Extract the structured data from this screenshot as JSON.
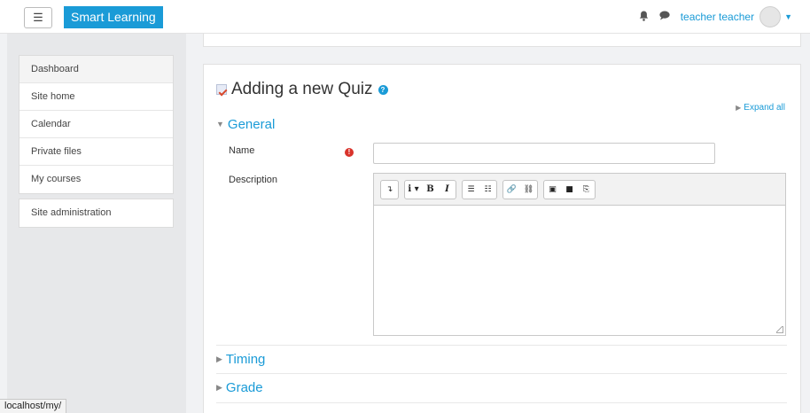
{
  "navbar": {
    "menu_icon": "☰",
    "brand": "Smart Learning",
    "bell_icon": "bell-icon",
    "chat_icon": "chat-icon",
    "user_name": "teacher teacher"
  },
  "drawer": {
    "items": [
      {
        "label": "Dashboard"
      },
      {
        "label": "Site home"
      },
      {
        "label": "Calendar"
      },
      {
        "label": "Private files"
      },
      {
        "label": "My courses"
      }
    ],
    "admin_label": "Site administration"
  },
  "main": {
    "heading": "Adding a new Quiz",
    "help_glyph": "?",
    "expand_all": "Expand all",
    "sections": {
      "general": "General",
      "timing": "Timing",
      "grade": "Grade"
    },
    "fields": {
      "name_label": "Name",
      "name_value": "",
      "required_glyph": "!",
      "description_label": "Description",
      "description_value": ""
    },
    "editor_toolbar": [
      [
        "↴"
      ],
      [
        "i ▾",
        "B",
        "I"
      ],
      [
        "☰",
        "☷"
      ],
      [
        "🔗",
        "⛓"
      ],
      [
        "▣",
        "■",
        "⎘"
      ]
    ]
  },
  "status_bar": {
    "url": "localhost/my/"
  },
  "colors": {
    "accent": "#1a9bd7",
    "required": "#d9332b",
    "background": "#f1f2f4"
  }
}
